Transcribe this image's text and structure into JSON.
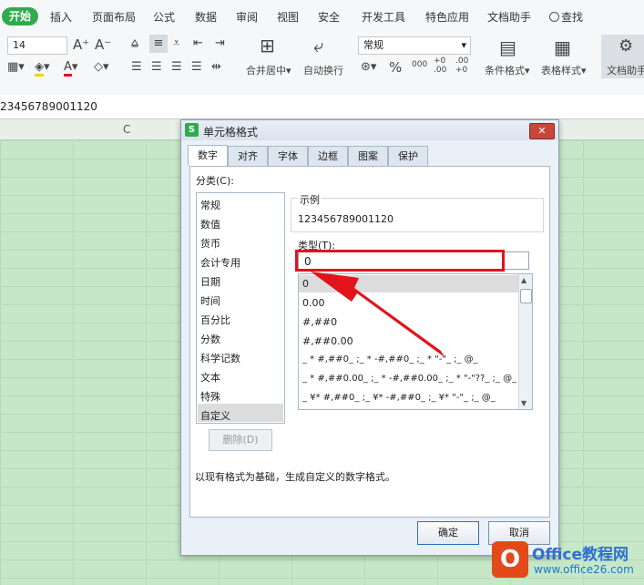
{
  "ribbon": {
    "tabs": [
      "开始",
      "插入",
      "页面布局",
      "公式",
      "数据",
      "审阅",
      "视图",
      "安全",
      "开发工具",
      "特色应用",
      "文档助手",
      "查找"
    ],
    "font_size": "14",
    "number_format": "常规",
    "merge_label": "合并居中",
    "wrap_label": "自动换行",
    "cond_format_label": "条件格式",
    "table_style_label": "表格样式",
    "doc_helper_label": "文档助手",
    "percent": "%",
    "thousands": "000",
    "inc_decimal": "+0 .00",
    "dec_decimal": ".00 +0"
  },
  "formula_bar": {
    "value": "23456789001120"
  },
  "column_header": "C",
  "dialog": {
    "title": "单元格格式",
    "close": "✕",
    "tabs": [
      "数字",
      "对齐",
      "字体",
      "边框",
      "图案",
      "保护"
    ],
    "category_label": "分类(C):",
    "categories": [
      "常规",
      "数值",
      "货币",
      "会计专用",
      "日期",
      "时间",
      "百分比",
      "分数",
      "科学记数",
      "文本",
      "特殊",
      "自定义"
    ],
    "sample_label": "示例",
    "sample_value": "123456789001120",
    "type_label": "类型(T):",
    "type_value": "0",
    "formats": [
      "0",
      "0.00",
      "#,##0",
      "#,##0.00",
      "_ * #,##0_ ;_ * -#,##0_ ;_ * \"-\"_ ;_ @_",
      "_ * #,##0.00_ ;_ * -#,##0.00_ ;_ * \"-\"??_ ;_ @_",
      "_ ¥* #,##0_ ;_ ¥* -#,##0_ ;_ ¥* \"-\"_ ;_ @_"
    ],
    "delete_label": "删除(D)",
    "hint": "以现有格式为基础，生成自定义的数字格式。",
    "ok_label": "确定",
    "cancel_label": "取消"
  },
  "watermark": {
    "brand": "Office教程网",
    "url": "www.office26.com"
  }
}
